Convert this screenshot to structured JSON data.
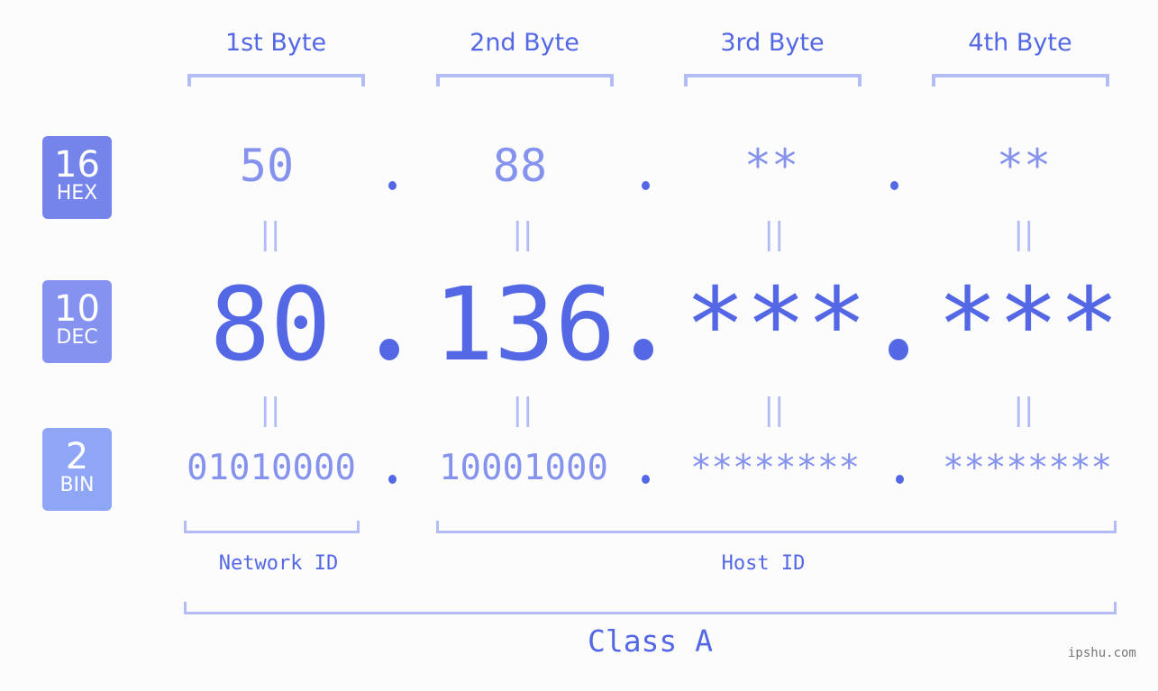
{
  "ip": {
    "byte_headers": [
      "1st Byte",
      "2nd Byte",
      "3rd Byte",
      "4th Byte"
    ],
    "separator": ".",
    "equals_symbol": "||",
    "rows": {
      "hex": {
        "base": "16",
        "label": "HEX",
        "values": [
          "50",
          "88",
          "**",
          "**"
        ]
      },
      "dec": {
        "base": "10",
        "label": "DEC",
        "values": [
          "80",
          "136",
          "***",
          "***"
        ]
      },
      "bin": {
        "base": "2",
        "label": "BIN",
        "values": [
          "01010000",
          "10001000",
          "********",
          "********"
        ]
      }
    },
    "network_id_label": "Network ID",
    "host_id_label": "Host ID",
    "class_label": "Class A"
  },
  "colors": {
    "primary": "#5468e5",
    "secondary": "#8592ee",
    "bracket": "#b3bcf5",
    "hex_badge": "#7584ea",
    "dec_badge": "#8592ef",
    "bin_badge": "#8fa6f7",
    "background": "#fbfcfb"
  },
  "watermark": "ipshu.com"
}
